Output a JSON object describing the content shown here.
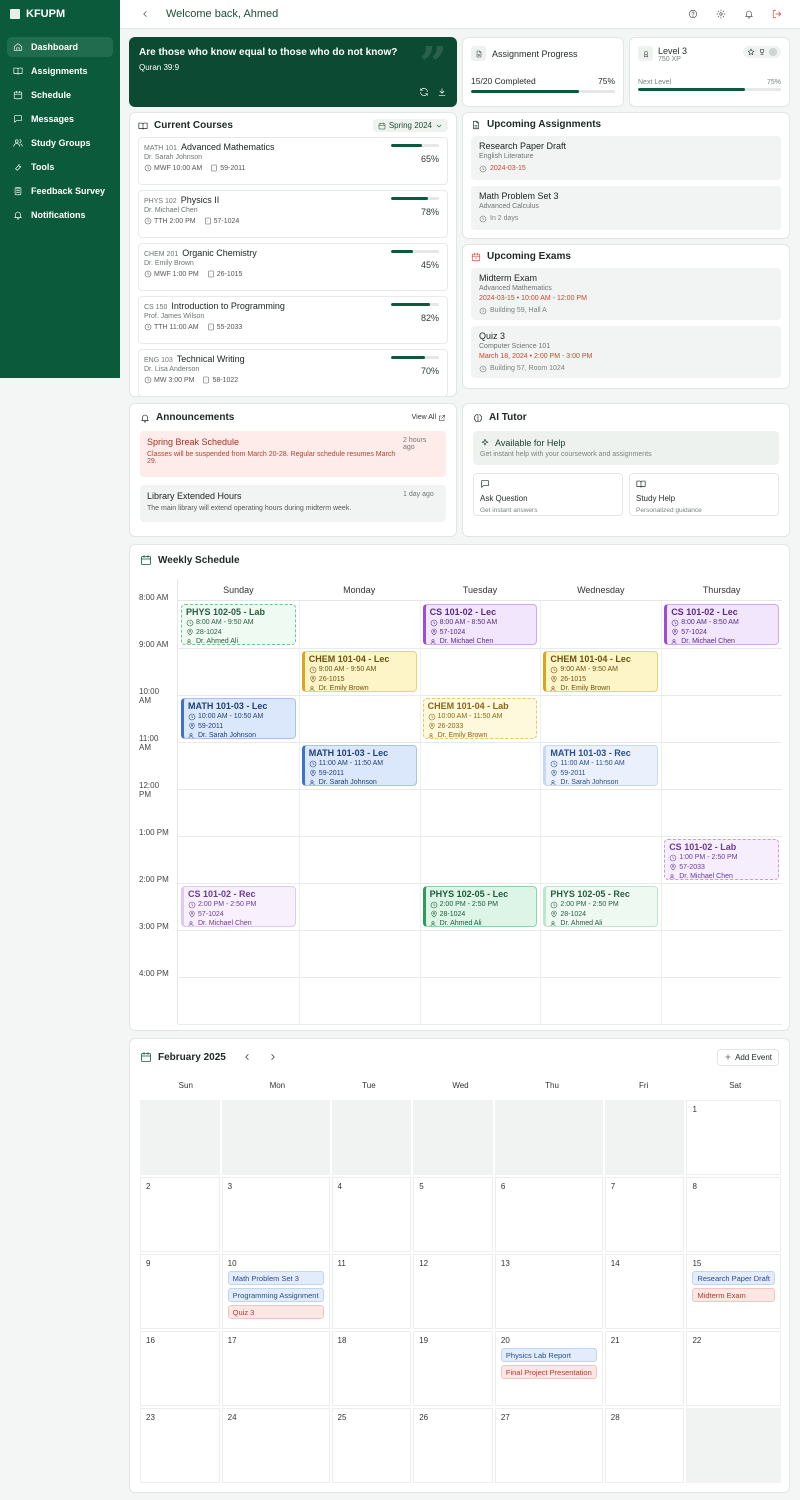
{
  "app": {
    "brand": "KFUPM"
  },
  "sidebar": {
    "items": [
      {
        "label": "Dashboard",
        "icon": "home-icon",
        "active": true
      },
      {
        "label": "Assignments",
        "icon": "book-open-icon"
      },
      {
        "label": "Schedule",
        "icon": "calendar-icon"
      },
      {
        "label": "Messages",
        "icon": "message-square-icon"
      },
      {
        "label": "Study Groups",
        "icon": "users-icon"
      },
      {
        "label": "Tools",
        "icon": "wrench-icon"
      },
      {
        "label": "Feedback Survey",
        "icon": "clipboard-icon"
      },
      {
        "label": "Notifications",
        "icon": "bell-icon"
      }
    ]
  },
  "header": {
    "title": "Welcome back, Ahmed"
  },
  "quote": {
    "text": "Are those who know equal to those who do not know?",
    "reference": "Quran 39:9"
  },
  "progress": {
    "title": "Assignment Progress",
    "completed": "15/20 Completed",
    "percent": "75%",
    "value": 0.75
  },
  "level": {
    "title": "Level 3",
    "xp": "750 XP",
    "next": "Next Level",
    "percent": "75%",
    "value": 0.75
  },
  "courses": {
    "title": "Current Courses",
    "term": "Spring 2024",
    "items": [
      {
        "code": "MATH 101",
        "name": "Advanced Mathematics",
        "instructor": "Dr. Sarah Johnson",
        "time": "MWF 10:00 AM",
        "room": "59-2011",
        "percent": "65%",
        "value": 0.65
      },
      {
        "code": "PHYS 102",
        "name": "Physics II",
        "instructor": "Dr. Michael Chen",
        "time": "TTH 2:00 PM",
        "room": "57-1024",
        "percent": "78%",
        "value": 0.78
      },
      {
        "code": "CHEM 201",
        "name": "Organic Chemistry",
        "instructor": "Dr. Emily Brown",
        "time": "MWF 1:00 PM",
        "room": "26-1015",
        "percent": "45%",
        "value": 0.45
      },
      {
        "code": "CS 150",
        "name": "Introduction to Programming",
        "instructor": "Prof. James Wilson",
        "time": "TTH 11:00 AM",
        "room": "55-2033",
        "percent": "82%",
        "value": 0.82
      },
      {
        "code": "ENG 103",
        "name": "Technical Writing",
        "instructor": "Dr. Lisa Anderson",
        "time": "MW 3:00 PM",
        "room": "58-1022",
        "percent": "70%",
        "value": 0.7
      }
    ]
  },
  "upcoming_assignments": {
    "title": "Upcoming Assignments",
    "items": [
      {
        "title": "Research Paper Draft",
        "course": "English Literature",
        "due": "2024-03-15",
        "urgent": true
      },
      {
        "title": "Math Problem Set 3",
        "course": "Advanced Calculus",
        "due": "In 2 days",
        "urgent": false
      }
    ]
  },
  "upcoming_exams": {
    "title": "Upcoming Exams",
    "items": [
      {
        "title": "Midterm Exam",
        "course": "Advanced Mathematics",
        "datetime": "2024-03-15 • 10:00 AM - 12:00 PM",
        "location": "Building 59, Hall A"
      },
      {
        "title": "Quiz 3",
        "course": "Computer Science 101",
        "datetime": "March 18, 2024 • 2:00 PM - 3:00 PM",
        "location": "Building 57, Room 1024"
      }
    ]
  },
  "announcements": {
    "title": "Announcements",
    "view_all": "View All",
    "items": [
      {
        "title": "Spring Break Schedule",
        "body": "Classes will be suspended from March 20-28. Regular schedule resumes March 29.",
        "when": "2 hours ago",
        "highlight": true
      },
      {
        "title": "Library Extended Hours",
        "body": "The main library will extend operating hours during midterm week.",
        "when": "1 day ago",
        "highlight": false
      }
    ]
  },
  "ai_tutor": {
    "title": "AI Tutor",
    "available_title": "Available for Help",
    "available_desc": "Get instant help with your coursework and assignments",
    "tiles": [
      {
        "title": "Ask Question",
        "desc": "Get instant answers",
        "icon": "message-square-icon"
      },
      {
        "title": "Study Help",
        "desc": "Personalized guidance",
        "icon": "book-open-icon"
      }
    ]
  },
  "weekly_schedule": {
    "title": "Weekly Schedule",
    "days": [
      "Sunday",
      "Monday",
      "Tuesday",
      "Wednesday",
      "Thursday"
    ],
    "times": [
      "8:00 AM",
      "9:00 AM",
      "10:00 AM",
      "11:00 AM",
      "12:00 PM",
      "1:00 PM",
      "2:00 PM",
      "3:00 PM",
      "4:00 PM"
    ],
    "events": [
      {
        "title": "PHYS 102-05 - Lab",
        "time": "8:00 AM - 9:50 AM",
        "room": "28-1024",
        "instructor": "Dr. Ahmed Ali",
        "day": 0,
        "start": 8,
        "style": "green-dashed"
      },
      {
        "title": "CS 101-02 - Lec",
        "time": "8:00 AM - 8:50 AM",
        "room": "57-1024",
        "instructor": "Dr. Michael Chen",
        "day": 2,
        "start": 8,
        "style": "purple"
      },
      {
        "title": "CS 101-02 - Lec",
        "time": "8:00 AM - 8:50 AM",
        "room": "57-1024",
        "instructor": "Dr. Michael Chen",
        "day": 4,
        "start": 8,
        "style": "purple"
      },
      {
        "title": "CHEM 101-04 - Lec",
        "time": "9:00 AM - 9:50 AM",
        "room": "26-1015",
        "instructor": "Dr. Emily Brown",
        "day": 1,
        "start": 9,
        "style": "yellow"
      },
      {
        "title": "CHEM 101-04 - Lec",
        "time": "9:00 AM - 9:50 AM",
        "room": "26-1015",
        "instructor": "Dr. Emily Brown",
        "day": 3,
        "start": 9,
        "style": "yellow"
      },
      {
        "title": "MATH 101-03 - Lec",
        "time": "10:00 AM - 10:50 AM",
        "room": "59-2011",
        "instructor": "Dr. Sarah Johnson",
        "day": 0,
        "start": 10,
        "style": "blue"
      },
      {
        "title": "CHEM 101-04 - Lab",
        "time": "10:00 AM - 11:50 AM",
        "room": "26-2033",
        "instructor": "Dr. Emily Brown",
        "day": 2,
        "start": 10,
        "style": "yellow-dashed"
      },
      {
        "title": "MATH 101-03 - Lec",
        "time": "11:00 AM - 11:50 AM",
        "room": "59-2011",
        "instructor": "Dr. Sarah Johnson",
        "day": 1,
        "start": 11,
        "style": "blue"
      },
      {
        "title": "MATH 101-03 - Rec",
        "time": "11:00 AM - 11:50 AM",
        "room": "59-2011",
        "instructor": "Dr. Sarah Johnson",
        "day": 3,
        "start": 11,
        "style": "blue-light"
      },
      {
        "title": "CS 101-02 - Lab",
        "time": "1:00 PM - 2:50 PM",
        "room": "57-2033",
        "instructor": "Dr. Michael Chen",
        "day": 4,
        "start": 13,
        "style": "purple-dashed"
      },
      {
        "title": "CS 101-02 - Rec",
        "time": "2:00 PM - 2:50 PM",
        "room": "57-1024",
        "instructor": "Dr. Michael Chen",
        "day": 0,
        "start": 14,
        "style": "purple-light"
      },
      {
        "title": "PHYS 102-05 - Lec",
        "time": "2:00 PM - 2:50 PM",
        "room": "28-1024",
        "instructor": "Dr. Ahmed Ali",
        "day": 2,
        "start": 14,
        "style": "green"
      },
      {
        "title": "PHYS 102-05 - Rec",
        "time": "2:00 PM - 2:50 PM",
        "room": "28-1024",
        "instructor": "Dr. Ahmed Ali",
        "day": 3,
        "start": 14,
        "style": "green-light"
      }
    ]
  },
  "calendar": {
    "month": "February 2025",
    "add_event": "Add Event",
    "weekdays": [
      "Sun",
      "Mon",
      "Tue",
      "Wed",
      "Thu",
      "Fri",
      "Sat"
    ],
    "first_weekday": 6,
    "days_in_month": 28,
    "events": {
      "10": [
        {
          "label": "Math Problem Set 3",
          "color": "blue"
        },
        {
          "label": "Programming Assignment",
          "color": "blue"
        },
        {
          "label": "Quiz 3",
          "color": "red"
        }
      ],
      "15": [
        {
          "label": "Research Paper Draft",
          "color": "blue"
        },
        {
          "label": "Midterm Exam",
          "color": "red"
        }
      ],
      "20": [
        {
          "label": "Physics Lab Report",
          "color": "blue"
        },
        {
          "label": "Final Project Presentation",
          "color": "red"
        }
      ]
    }
  },
  "colors": {
    "brand": "#0b5a3b",
    "brand_dark": "#0c4a33",
    "urgent": "#c8452d"
  }
}
